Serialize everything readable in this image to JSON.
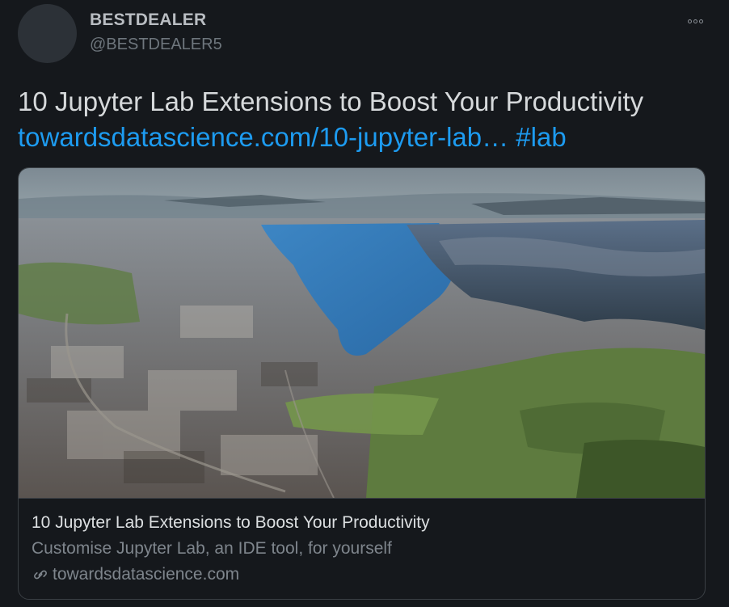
{
  "author": {
    "display_name": "BESTDEALER",
    "handle": "@BESTDEALER5"
  },
  "tweet": {
    "text": "10 Jupyter Lab Extensions to Boost Your Productivity",
    "link_text": "towardsdatascience.com/10-jupyter-lab…",
    "hashtag": "#lab"
  },
  "card": {
    "image_alt": "Aerial view of a coastal city beside a fjord with mountains",
    "title": "10 Jupyter Lab Extensions to Boost Your Productivity",
    "description": "Customise Jupyter Lab, an IDE tool, for yourself",
    "domain": "towardsdatascience.com"
  },
  "icons": {
    "more": "more-horizontal-icon",
    "link": "link-icon"
  },
  "colors": {
    "background": "#15181c",
    "link": "#1d9bf0",
    "muted": "#6e767d",
    "border": "#3a3f44"
  }
}
